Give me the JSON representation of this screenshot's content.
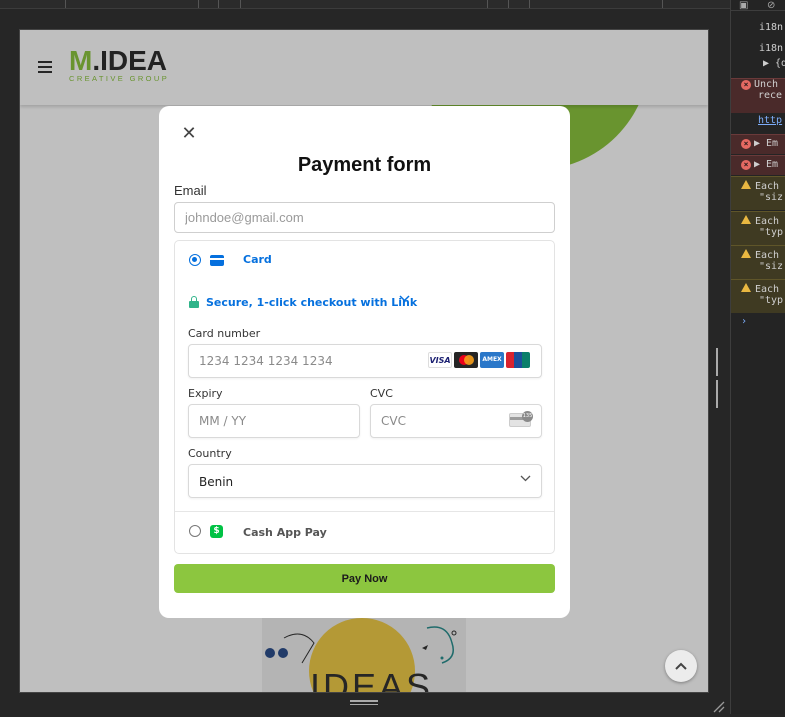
{
  "site": {
    "logo_mark": "M",
    "logo_rest": ".IDEA",
    "logo_tagline": "CREATIVE GROUP",
    "deco_word": "IDEAS"
  },
  "modal": {
    "close_glyph": "✕",
    "title": "Payment form",
    "email_label": "Email",
    "email_placeholder": "johndoe@gmail.com",
    "email_value": "",
    "pay_button": "Pay Now"
  },
  "payment": {
    "card_tab": "Card",
    "card_selected": true,
    "link_text": "Secure, 1-click checkout with Link",
    "card_number_label": "Card number",
    "card_number_placeholder": "1234 1234 1234 1234",
    "brands": [
      "VISA",
      "Mastercard",
      "AMEX",
      "UnionPay"
    ],
    "expiry_label": "Expiry",
    "expiry_placeholder": "MM / YY",
    "cvc_label": "CVC",
    "cvc_placeholder": "CVC",
    "cvc_badge": "135",
    "country_label": "Country",
    "country_value": "Benin",
    "cashapp_label": "Cash App Pay",
    "cashapp_glyph": "$"
  },
  "devtools": {
    "lines": [
      "i18n",
      "i18n",
      "▶ {d",
      "Unch",
      "rece",
      "http",
      "▶ Em",
      "▶ Em",
      "Each",
      "\"siz",
      "Each",
      "\"typ",
      "Each",
      "\"siz",
      "Each",
      "\"typ"
    ]
  },
  "colors": {
    "brand_green": "#8cc63f",
    "link_blue": "#0570de",
    "cashapp_green": "#00c244"
  }
}
